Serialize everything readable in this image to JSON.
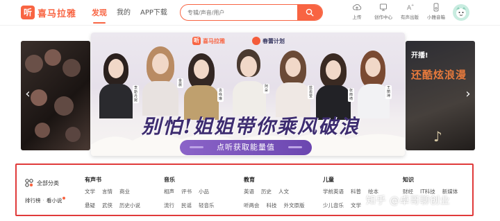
{
  "header": {
    "logo_mark": "听",
    "logo_text": "喜马拉雅",
    "nav": [
      {
        "label": "发现",
        "active": true
      },
      {
        "label": "我的",
        "active": false
      },
      {
        "label": "APP下载",
        "active": false
      }
    ],
    "search": {
      "placeholder": "专辑/声音/用户"
    },
    "tools": [
      {
        "label": "上传",
        "icon": "upload-icon"
      },
      {
        "label": "创作中心",
        "icon": "creator-center-icon"
      },
      {
        "label": "有声出版",
        "icon": "publish-icon"
      },
      {
        "label": "小雅音箱",
        "icon": "speaker-icon"
      }
    ],
    "brand_color": "#f86442"
  },
  "banner": {
    "logo": "喜马拉雅",
    "partner": "春蕾计划",
    "slogan": "别怕!姐姐带你乘风破浪",
    "cta": "点听获取能量值",
    "names": [
      "李斯丹妮",
      "金晨",
      "袁咏琳",
      "阿朵",
      "蓝盈莹",
      "张雨绮",
      "王丽坤",
      "张含韵"
    ],
    "side_right_tag": "开播!",
    "side_right_title": "还酷炫浪漫",
    "cta_color": "#7a55bf"
  },
  "categories": {
    "all_label": "全部分类",
    "quick_links": [
      "排行榜",
      "看小说"
    ],
    "groups": [
      {
        "title": "有声书",
        "rows": [
          [
            "文学",
            "言情",
            "商业"
          ],
          [
            "悬疑",
            "武侠",
            "历史小说"
          ]
        ]
      },
      {
        "title": "音乐",
        "rows": [
          [
            "相声",
            "评书",
            "小品"
          ],
          [
            "流行",
            "民谣",
            "轻音乐"
          ]
        ]
      },
      {
        "title": "教育",
        "rows": [
          [
            "英语",
            "历史",
            "人文"
          ],
          [
            "听两会",
            "科技",
            "外文原版"
          ]
        ]
      },
      {
        "title": "儿童",
        "rows": [
          [
            "学前英语",
            "科普",
            "绘本"
          ],
          [
            "少儿音乐",
            "文学",
            ""
          ]
        ]
      },
      {
        "title": "知识",
        "rows": [
          [
            "财经",
            "IT科技",
            "新媒体"
          ],
          [
            "",
            "",
            ""
          ]
        ]
      }
    ]
  },
  "watermark": "知乎 @卓哥聊创业"
}
